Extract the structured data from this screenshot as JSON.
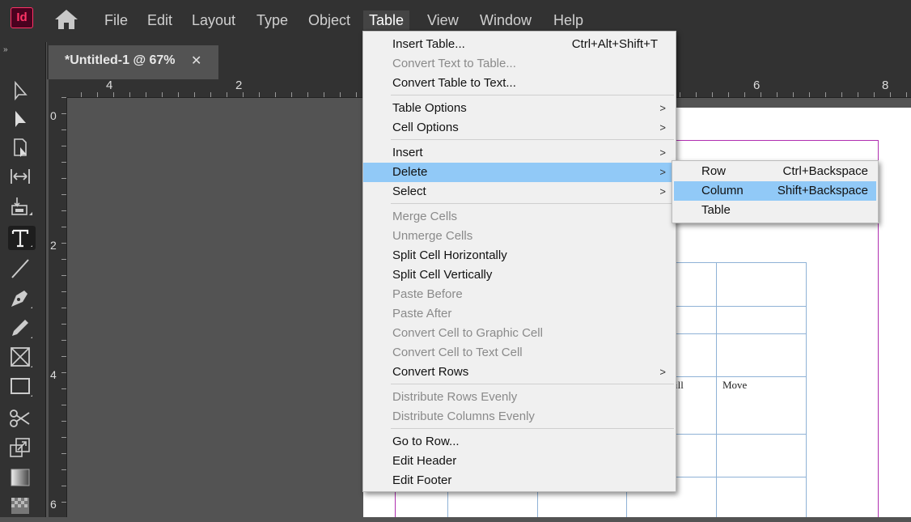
{
  "app": {
    "logo_text": "Id",
    "brand_color": "#ff3366"
  },
  "menubar": {
    "items": [
      "File",
      "Edit",
      "Layout",
      "Type",
      "Object",
      "Table",
      "View",
      "Window",
      "Help"
    ],
    "open_item": "Table"
  },
  "document_tab": {
    "title": "*Untitled-1 @ 67%",
    "close_label": "✕"
  },
  "panel_grip": "»",
  "rulers": {
    "horizontal_labels": [
      "4",
      "2",
      "6",
      "8"
    ],
    "vertical_labels": [
      "0",
      "2",
      "4",
      "6"
    ]
  },
  "table_menu": {
    "items": [
      {
        "label": "Insert Table...",
        "shortcut": "Ctrl+Alt+Shift+T",
        "enabled": true
      },
      {
        "label": "Convert Text to Table...",
        "enabled": false
      },
      {
        "label": "Convert Table to Text...",
        "enabled": true
      },
      {
        "label": "Table Options",
        "submenu": true,
        "enabled": true
      },
      {
        "label": "Cell Options",
        "submenu": true,
        "enabled": true
      },
      {
        "label": "Insert",
        "submenu": true,
        "enabled": true
      },
      {
        "label": "Delete",
        "submenu": true,
        "enabled": true,
        "highlighted": true
      },
      {
        "label": "Select",
        "submenu": true,
        "enabled": true
      },
      {
        "label": "Merge Cells",
        "enabled": false
      },
      {
        "label": "Unmerge Cells",
        "enabled": false
      },
      {
        "label": "Split Cell Horizontally",
        "enabled": true
      },
      {
        "label": "Split Cell Vertically",
        "enabled": true
      },
      {
        "label": "Paste Before",
        "enabled": false
      },
      {
        "label": "Paste After",
        "enabled": false
      },
      {
        "label": "Convert Cell to Graphic Cell",
        "enabled": false
      },
      {
        "label": "Convert Cell to Text Cell",
        "enabled": false
      },
      {
        "label": "Convert Rows",
        "submenu": true,
        "enabled": true
      },
      {
        "label": "Distribute Rows Evenly",
        "enabled": false
      },
      {
        "label": "Distribute Columns Evenly",
        "enabled": false
      },
      {
        "label": "Go to Row...",
        "enabled": true
      },
      {
        "label": "Edit Header",
        "enabled": true
      },
      {
        "label": "Edit Footer",
        "enabled": true
      }
    ]
  },
  "delete_submenu": {
    "items": [
      {
        "label": "Row",
        "shortcut": "Ctrl+Backspace"
      },
      {
        "label": "Column",
        "shortcut": "Shift+Backspace",
        "highlighted": true
      },
      {
        "label": "Table",
        "shortcut": ""
      }
    ]
  },
  "table_cells": {
    "partial_text": "ill",
    "move_text": "Move"
  },
  "colors": {
    "menu_highlight": "#91c9f7",
    "margin_guide": "#b02fb0",
    "table_stroke": "#8fb2d6"
  },
  "tools": [
    "selection-tool-icon",
    "direct-selection-tool-icon",
    "page-tool-icon",
    "gap-tool-icon",
    "content-collector-icon",
    "type-tool-icon",
    "line-tool-icon",
    "pen-tool-icon",
    "pencil-tool-icon",
    "rectangle-frame-tool-icon",
    "rectangle-tool-icon",
    "scissors-tool-icon",
    "free-transform-tool-icon",
    "gradient-swatch-tool-icon",
    "gradient-feather-tool-icon"
  ]
}
